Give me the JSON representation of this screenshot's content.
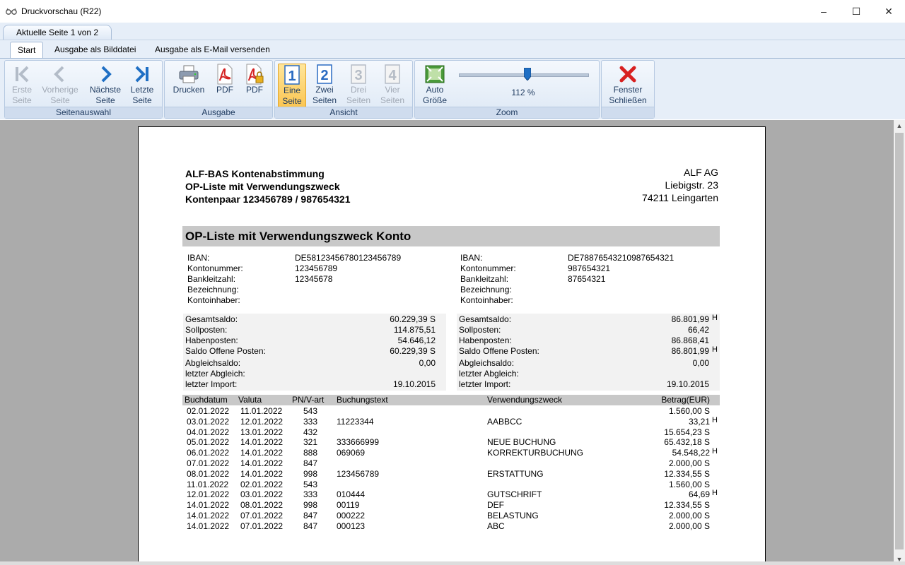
{
  "window": {
    "title": "Druckvorschau (R22)",
    "controls": [
      "–",
      "☐",
      "✕"
    ]
  },
  "page_tab": "Aktuelle Seite 1 von 2",
  "ribbon_tabs": [
    "Start",
    "Ausgabe als Bilddatei",
    "Ausgabe als E-Mail versenden"
  ],
  "ribbon": {
    "groups": {
      "seitenauswahl": "Seitenauswahl",
      "ausgabe": "Ausgabe",
      "ansicht": "Ansicht",
      "zoom": "Zoom",
      "close": ""
    },
    "buttons": {
      "first": [
        "Erste",
        "Seite"
      ],
      "prev": [
        "Vorherige",
        "Seite"
      ],
      "next": [
        "Nächste",
        "Seite"
      ],
      "last": [
        "Letzte",
        "Seite"
      ],
      "print": [
        "Drucken",
        ""
      ],
      "pdf1": [
        "PDF",
        ""
      ],
      "pdf2": [
        "PDF",
        ""
      ],
      "one": [
        "Eine",
        "Seite"
      ],
      "two": [
        "Zwei",
        "Seiten"
      ],
      "three": [
        "Drei",
        "Seiten"
      ],
      "four": [
        "Vier",
        "Seiten"
      ],
      "auto": [
        "Auto",
        "Größe"
      ],
      "close": [
        "Fenster",
        "Schließen"
      ]
    },
    "zoom_value": "112 %",
    "zoom_level_percent": 112
  },
  "report": {
    "title_lines": [
      "ALF-BAS Kontenabstimmung",
      "OP-Liste mit Verwendungszweck",
      "Kontenpaar 123456789 / 987654321"
    ],
    "company_lines": [
      "ALF AG",
      "Liebigstr. 23",
      "74211 Leingarten"
    ],
    "section_title": "OP-Liste mit Verwendungszweck Konto",
    "account_labels": [
      "IBAN:",
      "Kontonummer:",
      "Bankleitzahl:",
      "Bezeichnung:",
      "Kontoinhaber:"
    ],
    "account_left": [
      "DE58123456780123456789",
      "123456789",
      "12345678",
      "",
      ""
    ],
    "account_right": [
      "DE78876543210987654321",
      "987654321",
      "87654321",
      "",
      ""
    ],
    "saldo_labels": [
      "Gesamtsaldo:",
      "Sollposten:",
      "Habenposten:",
      "Saldo Offene Posten:"
    ],
    "saldo_left": [
      [
        "60.229,39 S",
        ""
      ],
      [
        "114.875,51",
        ""
      ],
      [
        "54.646,12",
        ""
      ],
      [
        "60.229,39 S",
        ""
      ]
    ],
    "saldo_right": [
      [
        "86.801,99",
        "H"
      ],
      [
        "66,42",
        ""
      ],
      [
        "86.868,41",
        ""
      ],
      [
        "86.801,99",
        "H"
      ]
    ],
    "abgleich_labels": [
      "Abgleichsaldo:",
      "letzter Abgleich:",
      "letzter Import:"
    ],
    "abgleich_left": [
      "0,00",
      "",
      "19.10.2015"
    ],
    "abgleich_right": [
      "0,00",
      "",
      "19.10.2015"
    ],
    "table": {
      "headers": [
        "Buchdatum",
        "Valuta",
        "PN/V-art",
        "Buchungstext",
        "Verwendungszweck",
        "Betrag(EUR)"
      ],
      "rows": [
        [
          "02.01.2022",
          "11.01.2022",
          "543",
          "",
          "",
          "1.560,00 S",
          ""
        ],
        [
          "03.01.2022",
          "12.01.2022",
          "333",
          "11223344",
          "AABBCC",
          "33,21",
          "H"
        ],
        [
          "04.01.2022",
          "13.01.2022",
          "432",
          "",
          "",
          "15.654,23 S",
          ""
        ],
        [
          "05.01.2022",
          "14.01.2022",
          "321",
          "333666999",
          "NEUE BUCHUNG",
          "65.432,18 S",
          ""
        ],
        [
          "06.01.2022",
          "14.01.2022",
          "888",
          "069069",
          "KORREKTURBUCHUNG",
          "54.548,22",
          "H"
        ],
        [
          "07.01.2022",
          "14.01.2022",
          "847",
          "",
          "",
          "2.000,00 S",
          ""
        ],
        [
          "08.01.2022",
          "14.01.2022",
          "998",
          "123456789",
          "ERSTATTUNG",
          "12.334,55 S",
          ""
        ],
        [
          "11.01.2022",
          "02.01.2022",
          "543",
          "",
          "",
          "1.560,00 S",
          ""
        ],
        [
          "12.01.2022",
          "03.01.2022",
          "333",
          "010444",
          "GUTSCHRIFT",
          "64,69",
          "H"
        ],
        [
          "14.01.2022",
          "08.01.2022",
          "998",
          "00119",
          "DEF",
          "12.334,55 S",
          ""
        ],
        [
          "14.01.2022",
          "07.01.2022",
          "847",
          "000222",
          "BELASTUNG",
          "2.000,00 S",
          ""
        ],
        [
          "14.01.2022",
          "07.01.2022",
          "847",
          "000123",
          "ABC",
          "2.000,00 S",
          ""
        ]
      ]
    }
  }
}
